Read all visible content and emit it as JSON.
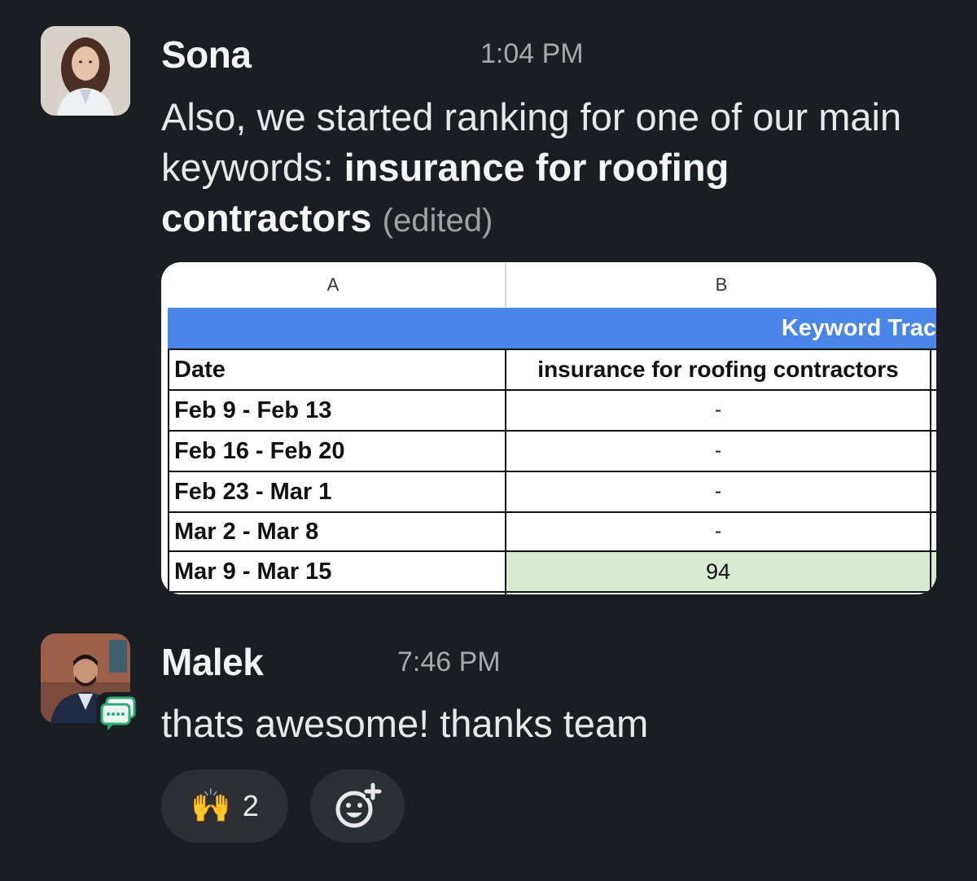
{
  "messages": [
    {
      "author": "Sona",
      "time": "1:04 PM",
      "text_plain": "Also, we started ranking for one of our main keywords: ",
      "text_bold": "insurance for roofing contractors",
      "edited_label": "(edited)"
    },
    {
      "author": "Malek",
      "time": "7:46 PM",
      "text_plain": "thats awesome! thanks team"
    }
  ],
  "sheet": {
    "columns": [
      "A",
      "B"
    ],
    "banner": "Keyword Trac",
    "header": [
      "Date",
      "insurance for roofing contractors"
    ],
    "rows": [
      [
        "Feb 9 - Feb 13",
        "-"
      ],
      [
        "Feb 16 - Feb 20",
        "-"
      ],
      [
        "Feb 23 - Mar 1",
        "-"
      ],
      [
        "Mar 2 - Mar 8",
        "-"
      ],
      [
        "Mar 9 - Mar 15",
        "94"
      ]
    ],
    "highlight_color": "#d9ead3",
    "banner_color": "#4a86e8"
  },
  "reactions": [
    {
      "emoji": "🙌",
      "count": "2"
    }
  ],
  "icons": {
    "add_reaction": "add-reaction-icon",
    "status": "chat-bubble-status-icon"
  }
}
